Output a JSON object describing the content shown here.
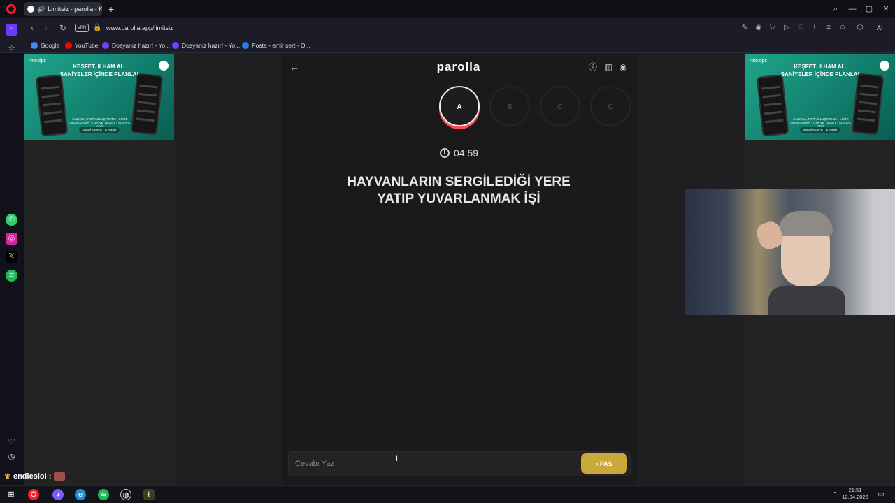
{
  "browser": {
    "tab_title": "Limitsiz - parolla - Ke",
    "new_tab": "+",
    "url": "www.parolla.app/limitsiz",
    "vpn": "VPN",
    "ai_label": "AI",
    "bookmarks": [
      {
        "label": "Google",
        "icon": "google-icon",
        "color": "#4285f4"
      },
      {
        "label": "YouTube",
        "icon": "youtube-icon",
        "color": "#ff0000"
      },
      {
        "label": "Dosyanız hazır! - Yo...",
        "icon": "bookmark-icon",
        "color": "#7a3cff"
      },
      {
        "label": "Dosyanız hazır! - Yo...",
        "icon": "bookmark-icon",
        "color": "#7a3cff"
      },
      {
        "label": "Posta - emir sert - O...",
        "icon": "outlook-icon",
        "color": "#2c7be5"
      }
    ]
  },
  "ads": {
    "brand": "roto.tips",
    "headline_1": "KEŞFET. İLHAM AL.",
    "headline_2": "SANİYELER İÇİNDE PLANLA!",
    "small_text": "HAZIRLA, ROTA OLUŞTURMA · LİSTE OLUŞTURMA · TUR VE TICKET · SOSYAL AKIŞ",
    "cta": "ŞİMDİ KEŞFET & İNDİR"
  },
  "game": {
    "logo": "parolla",
    "letters": [
      {
        "label": "A",
        "state": "active"
      },
      {
        "label": "B",
        "state": "idle"
      },
      {
        "label": "C",
        "state": "idle"
      },
      {
        "label": "Ç",
        "state": "idle"
      }
    ],
    "timer": "04:59",
    "question_line1": "HAYVANLARIN SERGİLEDİĞİ YERE",
    "question_line2": "YATIP YUVARLANMAK İŞİ",
    "answer_placeholder": "Cevabı Yaz",
    "pass_label": "PAS"
  },
  "overlay": {
    "username": "endleslol :"
  },
  "taskbar": {
    "time": "21:51",
    "date": "12.04.2026"
  },
  "colors": {
    "accent_red": "#ff4a57",
    "pass_gold": "#c9a93a",
    "ad_green": "#1fa58a"
  }
}
